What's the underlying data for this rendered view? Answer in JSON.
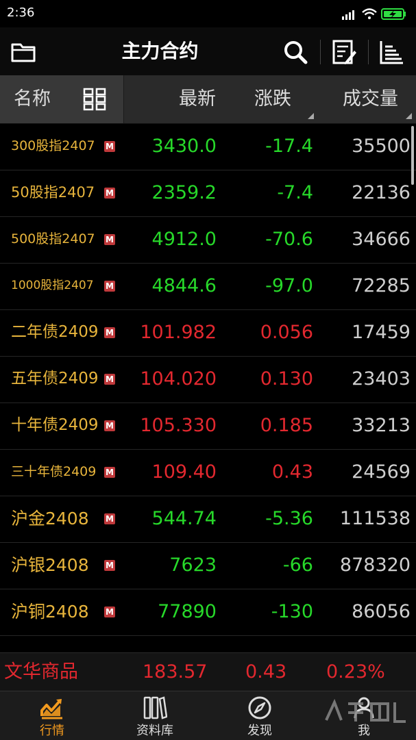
{
  "status_bar": {
    "time": "2:36"
  },
  "header": {
    "title": "主力合约"
  },
  "columns": {
    "name": "名称",
    "last": "最新",
    "change": "涨跌",
    "volume": "成交量"
  },
  "rows": [
    {
      "name": "300股指2407",
      "last": "3430.0",
      "change": "-17.4",
      "volume": "35500",
      "dir": "down",
      "name_size": 19
    },
    {
      "name": "50股指2407",
      "last": "2359.2",
      "change": "-7.4",
      "volume": "22136",
      "dir": "down",
      "name_size": 21
    },
    {
      "name": "500股指2407",
      "last": "4912.0",
      "change": "-70.6",
      "volume": "34666",
      "dir": "down",
      "name_size": 19
    },
    {
      "name": "1000股指2407",
      "last": "4844.6",
      "change": "-97.0",
      "volume": "72285",
      "dir": "down",
      "name_size": 17
    },
    {
      "name": "二年债2409",
      "last": "101.982",
      "change": "0.056",
      "volume": "17459",
      "dir": "up",
      "name_size": 23
    },
    {
      "name": "五年债2409",
      "last": "104.020",
      "change": "0.130",
      "volume": "23403",
      "dir": "up",
      "name_size": 23
    },
    {
      "name": "十年债2409",
      "last": "105.330",
      "change": "0.185",
      "volume": "33213",
      "dir": "up",
      "name_size": 23
    },
    {
      "name": "三十年债2409",
      "last": "109.40",
      "change": "0.43",
      "volume": "24569",
      "dir": "up",
      "name_size": 19
    },
    {
      "name": "沪金2408",
      "last": "544.74",
      "change": "-5.36",
      "volume": "111538",
      "dir": "down",
      "name_size": 25
    },
    {
      "name": "沪银2408",
      "last": "7623",
      "change": "-66",
      "volume": "878320",
      "dir": "down",
      "name_size": 25
    },
    {
      "name": "沪铜2408",
      "last": "77890",
      "change": "-130",
      "volume": "86056",
      "dir": "down",
      "name_size": 25
    }
  ],
  "badge": "M",
  "ticker": {
    "name": "文华商品",
    "value": "183.57",
    "change": "0.43",
    "percent": "0.23%"
  },
  "nav": [
    {
      "label": "行情",
      "icon": "chart-trend-icon",
      "active": true
    },
    {
      "label": "资料库",
      "icon": "books-icon",
      "active": false
    },
    {
      "label": "发现",
      "icon": "compass-icon",
      "active": false
    },
    {
      "label": "我",
      "icon": "user-icon",
      "active": false
    }
  ],
  "colors": {
    "up": "#e3282f",
    "down": "#27d92a",
    "name": "#e8b53c",
    "accent": "#f29a1f"
  }
}
